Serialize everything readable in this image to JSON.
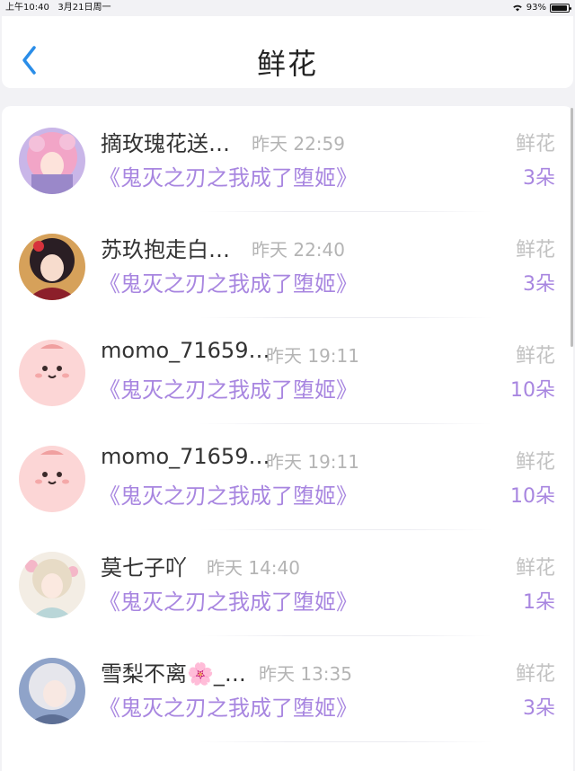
{
  "status_bar": {
    "time": "上午10:40",
    "date": "3月21日周一",
    "battery": "93%",
    "battery_level": 0.93
  },
  "nav": {
    "title": "鲜花"
  },
  "records": [
    {
      "name": "摘玫瑰花送…",
      "time": "昨天 22:59",
      "book": "《鬼灭之刃之我成了堕姬》",
      "gift": "鲜花",
      "count": "3朵",
      "avatar": "pink-hair-girl-avatar"
    },
    {
      "name": "苏玖抱走白…",
      "time": "昨天 22:40",
      "book": "《鬼灭之刃之我成了堕姬》",
      "gift": "鲜花",
      "count": "3朵",
      "avatar": "red-kimono-girl-avatar"
    },
    {
      "name": "momo_71659…",
      "time": "昨天 19:11",
      "book": "《鬼灭之刃之我成了堕姬》",
      "gift": "鲜花",
      "count": "10朵",
      "avatar": "pink-cartoon-avatar"
    },
    {
      "name": "momo_71659…",
      "time": "昨天 19:11",
      "book": "《鬼灭之刃之我成了堕姬》",
      "gift": "鲜花",
      "count": "10朵",
      "avatar": "pink-cartoon-avatar"
    },
    {
      "name": "莫七子吖",
      "time": "昨天 14:40",
      "book": "《鬼灭之刃之我成了堕姬》",
      "gift": "鲜花",
      "count": "1朵",
      "avatar": "flower-girl-avatar"
    },
    {
      "name": "雪梨不离🌸_…",
      "time": "昨天 13:35",
      "book": "《鬼灭之刃之我成了堕姬》",
      "gift": "鲜花",
      "count": "3朵",
      "avatar": "silver-hair-girl-avatar"
    }
  ]
}
